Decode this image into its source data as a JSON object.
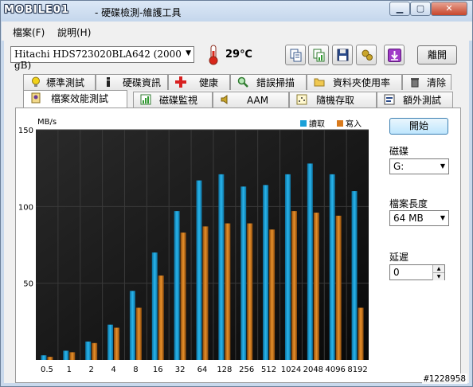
{
  "window": {
    "title_logo": "MOBILE01",
    "title": "- 硬碟檢測-維護工具",
    "controls": {
      "minimize": "▁",
      "maximize": "▢",
      "close": "✕"
    }
  },
  "menu": {
    "items": [
      {
        "label": "檔案(F)"
      },
      {
        "label": "說明(H)"
      }
    ]
  },
  "toolbar": {
    "drive": "Hitachi HDS723020BLA642  (2000 gB)",
    "temperature": "29℃",
    "exit_label": "離開",
    "icons": [
      "copy-text-icon",
      "copy-chart-icon",
      "save-icon",
      "options-icon",
      "download-icon"
    ]
  },
  "tabs": {
    "row1": [
      {
        "label": "標準測試",
        "icon": "bulb-icon"
      },
      {
        "label": "硬碟資訊",
        "icon": "info-icon"
      },
      {
        "label": "健康",
        "icon": "health-icon"
      },
      {
        "label": "錯誤掃描",
        "icon": "magnifier-icon"
      },
      {
        "label": "資料夾使用率",
        "icon": "folder-icon"
      },
      {
        "label": "清除",
        "icon": "trash-icon"
      }
    ],
    "row2": [
      {
        "label": "檔案效能測試",
        "icon": "file-benchmark-icon",
        "active": true
      },
      {
        "label": "磁碟監視",
        "icon": "monitor-chart-icon"
      },
      {
        "label": "AAM",
        "icon": "speaker-icon"
      },
      {
        "label": "隨機存取",
        "icon": "random-access-icon"
      },
      {
        "label": "額外測試",
        "icon": "extra-test-icon"
      }
    ]
  },
  "side": {
    "start_label": "開始",
    "disk_label": "磁碟",
    "disk_value": "G:",
    "file_length_label": "檔案長度",
    "file_length_value": "64 MB",
    "delay_label": "延遲",
    "delay_value": "0"
  },
  "watermark": "#1228958",
  "colors": {
    "read": "#1aa0d8",
    "write": "#d97a1c",
    "chart_bg": "#111111",
    "grid": "#3a3a3a"
  },
  "chart_data": {
    "type": "bar",
    "ylabel": "MB/s",
    "ylim": [
      0,
      150
    ],
    "yticks": [
      50,
      100,
      150
    ],
    "legend_position": "top-right",
    "categories": [
      "0.5",
      "1",
      "2",
      "4",
      "8",
      "16",
      "32",
      "64",
      "128",
      "256",
      "512",
      "1024",
      "2048",
      "4096",
      "8192"
    ],
    "series": [
      {
        "name": "讀取",
        "values": [
          3,
          6,
          12,
          23,
          45,
          70,
          97,
          117,
          121,
          113,
          114,
          121,
          128,
          121,
          110
        ]
      },
      {
        "name": "寫入",
        "values": [
          2,
          5,
          11,
          21,
          34,
          55,
          83,
          87,
          89,
          89,
          85,
          97,
          96,
          94,
          34
        ]
      }
    ]
  }
}
